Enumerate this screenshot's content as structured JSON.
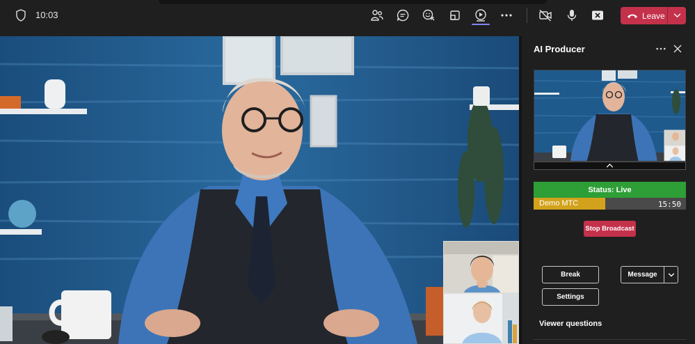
{
  "header": {
    "time": "10:03",
    "leave_label": "Leave",
    "icons": [
      "shield-icon",
      "people-icon",
      "chat-icon",
      "react-icon",
      "rooms-icon",
      "share-icon",
      "more-icon",
      "camera-off-icon",
      "mic-icon",
      "share-stop-icon"
    ]
  },
  "panel": {
    "title": "AI Producer",
    "status": "Status: Live",
    "progress_label": "Demo MTC",
    "progress_time": "15:50",
    "progress_fraction": 0.47,
    "stop_label": "Stop Broadcast",
    "break_label": "Break",
    "settings_label": "Settings",
    "message_label": "Message",
    "viewer_questions_label": "Viewer questions"
  },
  "colors": {
    "leave": "#c4314b",
    "status_live": "#2e9e36",
    "progress": "#d2a21c",
    "active_indicator": "#7f85f5"
  }
}
